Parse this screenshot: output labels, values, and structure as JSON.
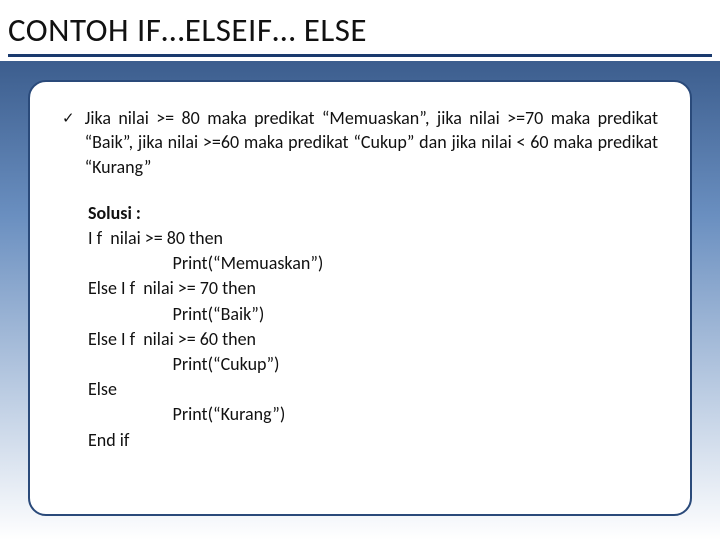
{
  "title": "CONTOH IF…ELSEIF… ELSE",
  "bullet_icon": "✓",
  "problem": "Jika nilai >= 80 maka predikat “Memuaskan”, jika nilai >=70 maka predikat “Baik”, jika nilai >=60 maka predikat “Cukup” dan jika nilai < 60 maka predikat “Kurang”",
  "solution": {
    "label": "Solusi :",
    "lines": [
      "I f  nilai >= 80 then",
      "        Print(“Memuaskan”)",
      "Else I f  nilai >= 70 then",
      "        Print(“Baik”)",
      "Else I f  nilai >= 60 then",
      "        Print(“Cukup”)",
      "Else",
      "        Print(“Kurang”)",
      "End if"
    ]
  }
}
